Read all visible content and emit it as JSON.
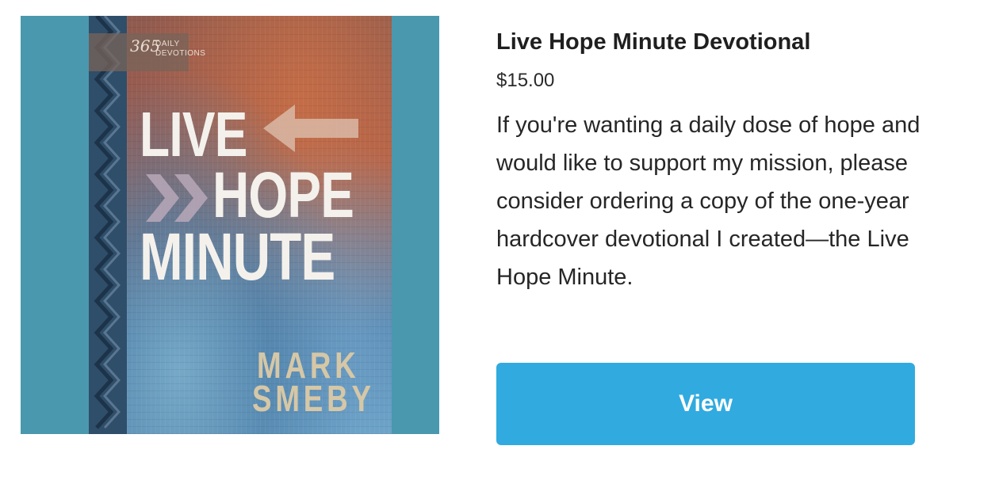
{
  "product": {
    "title": "Live Hope Minute Devotional",
    "price": "$15.00",
    "description": "If you're wanting a daily dose of hope and would like to support my mission, please consider ordering a copy of the one-year hardcover devotional I created—the Live Hope Minute.",
    "button_label": "View"
  },
  "cover": {
    "badge_number": "365",
    "badge_line1": "DAILY",
    "badge_line2": "DEVOTIONS",
    "title_line1": "LIVE",
    "title_line2": "HOPE",
    "title_line3": "MINUTE",
    "author_first": "MARK",
    "author_last": "SMEBY"
  },
  "colors": {
    "button_background": "#31aadf",
    "image_background": "#4a98ae",
    "text": "#222222"
  }
}
